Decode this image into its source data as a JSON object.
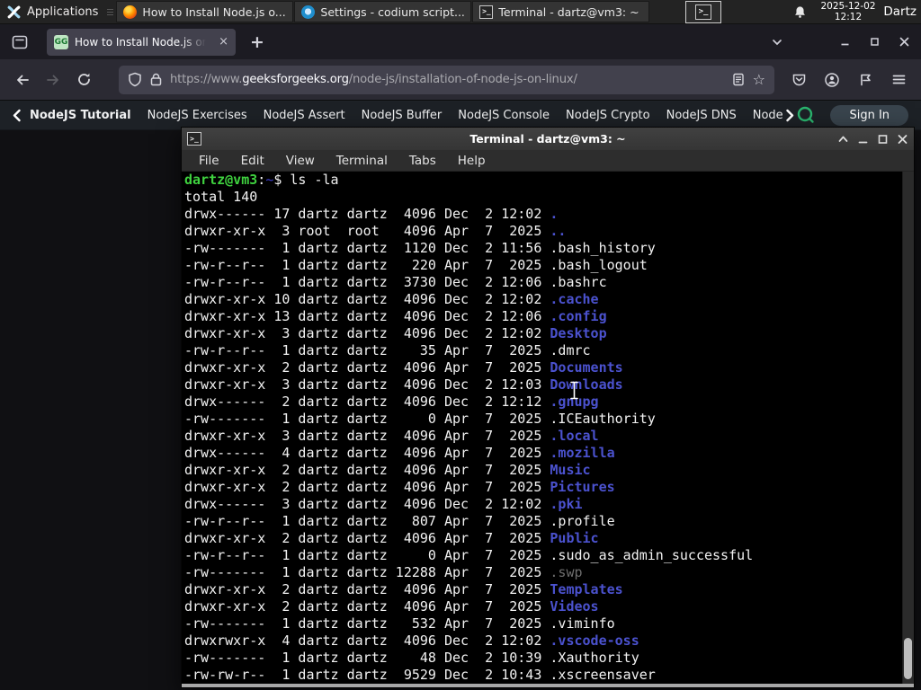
{
  "panel": {
    "applications_label": "Applications",
    "window_buttons": [
      {
        "title": "How to Install Node.js o...",
        "icon": "firefox"
      },
      {
        "title": "Settings - codium script...",
        "icon": "codium"
      },
      {
        "title": "Terminal - dartz@vm3: ~",
        "icon": "terminal"
      }
    ],
    "clock_date": "2025-12-02",
    "clock_time": "12:12",
    "user": "Dartz"
  },
  "browser": {
    "tab_title": "How to Install Node.js on",
    "favicon_text": "GG",
    "new_tab_label": "+",
    "tab_close_label": "×",
    "url_prefix": "https://www.",
    "url_domain": "geeksforgeeks.org",
    "url_path": "/node-js/installation-of-node-js-on-linux/",
    "star_glyph": "☆"
  },
  "gfg_nav": {
    "items": [
      "NodeJS Tutorial",
      "NodeJS Exercises",
      "NodeJS Assert",
      "NodeJS Buffer",
      "NodeJS Console",
      "NodeJS Crypto",
      "NodeJS DNS",
      "Node"
    ],
    "sign_in_label": "Sign In",
    "accent_green": "#2ab56e"
  },
  "terminal": {
    "window_title": "Terminal - dartz@vm3: ~",
    "menu_items": [
      "File",
      "Edit",
      "View",
      "Terminal",
      "Tabs",
      "Help"
    ],
    "prompt_user_host": "dartz@vm3",
    "prompt_separator": ":",
    "prompt_cwd": "~",
    "prompt_suffix": "$ ",
    "command": "ls -la",
    "total_line": "total 140",
    "listing": [
      {
        "m": "drwx------ 17 dartz dartz  4096 Dec  2 12:02 ",
        "n": ".",
        "t": "dir"
      },
      {
        "m": "drwxr-xr-x  3 root  root   4096 Apr  7  2025 ",
        "n": "..",
        "t": "dir"
      },
      {
        "m": "-rw-------  1 dartz dartz  1120 Dec  2 11:56 ",
        "n": ".bash_history",
        "t": "file"
      },
      {
        "m": "-rw-r--r--  1 dartz dartz   220 Apr  7  2025 ",
        "n": ".bash_logout",
        "t": "file"
      },
      {
        "m": "-rw-r--r--  1 dartz dartz  3730 Dec  2 12:06 ",
        "n": ".bashrc",
        "t": "file"
      },
      {
        "m": "drwxr-xr-x 10 dartz dartz  4096 Dec  2 12:02 ",
        "n": ".cache",
        "t": "dir"
      },
      {
        "m": "drwxr-xr-x 13 dartz dartz  4096 Dec  2 12:06 ",
        "n": ".config",
        "t": "dir"
      },
      {
        "m": "drwxr-xr-x  3 dartz dartz  4096 Dec  2 12:02 ",
        "n": "Desktop",
        "t": "dir"
      },
      {
        "m": "-rw-r--r--  1 dartz dartz    35 Apr  7  2025 ",
        "n": ".dmrc",
        "t": "file"
      },
      {
        "m": "drwxr-xr-x  2 dartz dartz  4096 Apr  7  2025 ",
        "n": "Documents",
        "t": "dir"
      },
      {
        "m": "drwxr-xr-x  3 dartz dartz  4096 Dec  2 12:03 ",
        "n": "Downloads",
        "t": "dir"
      },
      {
        "m": "drwx------  2 dartz dartz  4096 Dec  2 12:12 ",
        "n": ".gnupg",
        "t": "dir"
      },
      {
        "m": "-rw-------  1 dartz dartz     0 Apr  7  2025 ",
        "n": ".ICEauthority",
        "t": "file"
      },
      {
        "m": "drwxr-xr-x  3 dartz dartz  4096 Apr  7  2025 ",
        "n": ".local",
        "t": "dir"
      },
      {
        "m": "drwx------  4 dartz dartz  4096 Apr  7  2025 ",
        "n": ".mozilla",
        "t": "dir"
      },
      {
        "m": "drwxr-xr-x  2 dartz dartz  4096 Apr  7  2025 ",
        "n": "Music",
        "t": "dir"
      },
      {
        "m": "drwxr-xr-x  2 dartz dartz  4096 Apr  7  2025 ",
        "n": "Pictures",
        "t": "dir"
      },
      {
        "m": "drwx------  3 dartz dartz  4096 Dec  2 12:02 ",
        "n": ".pki",
        "t": "dir"
      },
      {
        "m": "-rw-r--r--  1 dartz dartz   807 Apr  7  2025 ",
        "n": ".profile",
        "t": "file"
      },
      {
        "m": "drwxr-xr-x  2 dartz dartz  4096 Apr  7  2025 ",
        "n": "Public",
        "t": "dir"
      },
      {
        "m": "-rw-r--r--  1 dartz dartz     0 Apr  7  2025 ",
        "n": ".sudo_as_admin_successful",
        "t": "file"
      },
      {
        "m": "-rw-------  1 dartz dartz 12288 Apr  7  2025 ",
        "n": ".swp",
        "t": "dim"
      },
      {
        "m": "drwxr-xr-x  2 dartz dartz  4096 Apr  7  2025 ",
        "n": "Templates",
        "t": "dir"
      },
      {
        "m": "drwxr-xr-x  2 dartz dartz  4096 Apr  7  2025 ",
        "n": "Videos",
        "t": "dir"
      },
      {
        "m": "-rw-------  1 dartz dartz   532 Apr  7  2025 ",
        "n": ".viminfo",
        "t": "file"
      },
      {
        "m": "drwxrwxr-x  4 dartz dartz  4096 Dec  2 12:02 ",
        "n": ".vscode-oss",
        "t": "dir"
      },
      {
        "m": "-rw-------  1 dartz dartz    48 Dec  2 10:39 ",
        "n": ".Xauthority",
        "t": "file"
      },
      {
        "m": "-rw-rw-r--  1 dartz dartz  9529 Dec  2 10:43 ",
        "n": ".xscreensaver",
        "t": "file"
      }
    ],
    "colors": {
      "background": "#000000",
      "foreground": "#f2f2f2",
      "prompt_green": "#3fd23f",
      "cwd_blue": "#3c3ccc",
      "directory_blue": "#4b52cf",
      "dim_file": "#6e6e6e"
    }
  }
}
